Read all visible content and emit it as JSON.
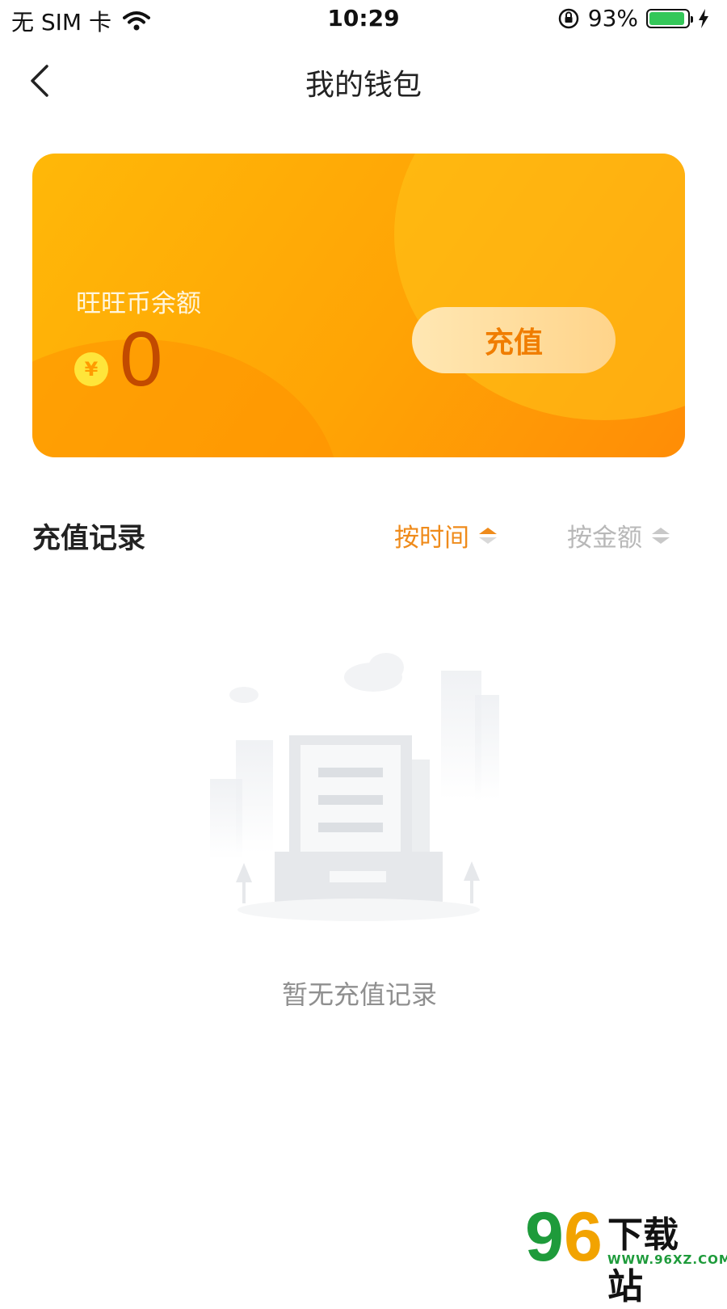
{
  "status_bar": {
    "carrier": "无 SIM 卡",
    "time": "10:29",
    "battery_percent_text": "93%",
    "battery_level": 0.93,
    "battery_color": "#34c759"
  },
  "nav": {
    "title": "我的钱包",
    "back_icon": "chevron-left-icon"
  },
  "wallet": {
    "balance_label": "旺旺币余额",
    "currency_symbol": "¥",
    "balance": "0",
    "recharge_label": "充值",
    "accent_color": "#ffa405"
  },
  "records": {
    "title": "充值记录",
    "sort_options": [
      {
        "label": "按时间",
        "active": true,
        "color": "#ef8b1b"
      },
      {
        "label": "按金额",
        "active": false,
        "color": "#b8b8b8"
      }
    ],
    "empty_text": "暂无充值记录"
  },
  "watermark": {
    "nine": "9",
    "six": "6",
    "text": "下载站",
    "url": "WWW.96XZ.COM"
  }
}
